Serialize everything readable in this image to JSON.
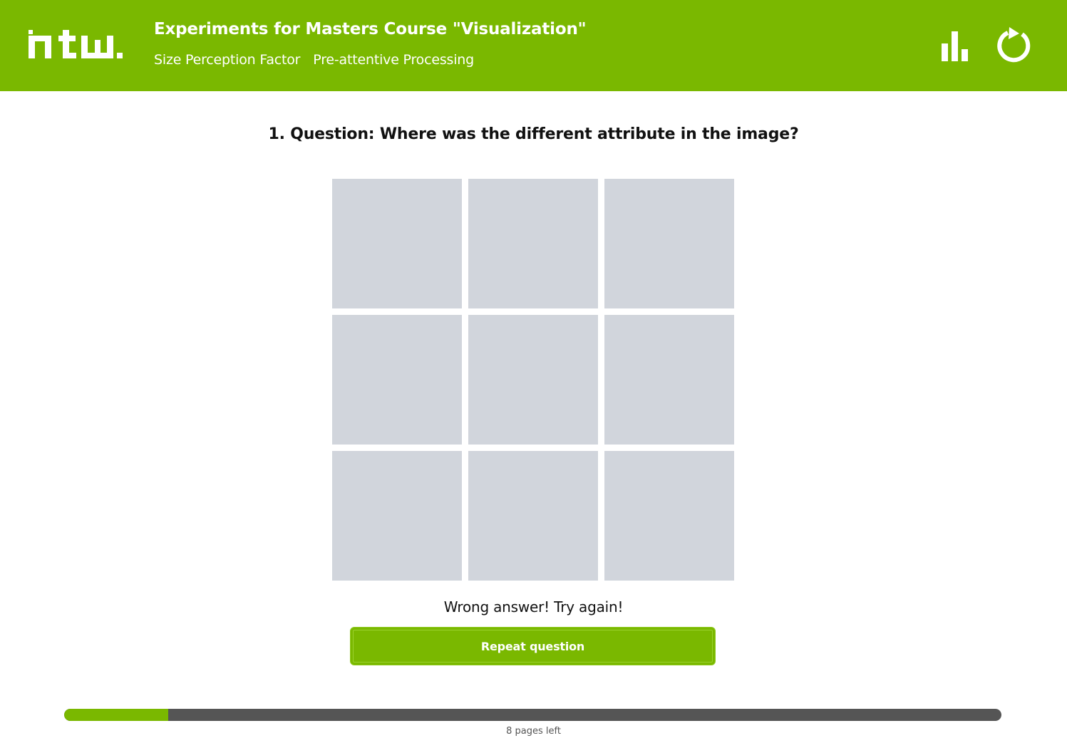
{
  "header": {
    "logo_text": "htw",
    "title": "Experiments for Masters Course \"Visualization\"",
    "nav": [
      {
        "label": "Size Perception Factor"
      },
      {
        "label": "Pre-attentive Processing"
      }
    ],
    "stats_icon": "bar-chart-icon",
    "restart_icon": "restart-icon",
    "background_color": "#7ab800"
  },
  "main": {
    "question": "1. Question: Where was the different attribute in the image?",
    "grid_cells": 9,
    "cell_color": "#d1d5dc",
    "feedback": "Wrong answer! Try again!",
    "repeat_label": "Repeat question"
  },
  "progress": {
    "fraction_complete": 0.111,
    "pages_left_text": "8 pages left"
  }
}
